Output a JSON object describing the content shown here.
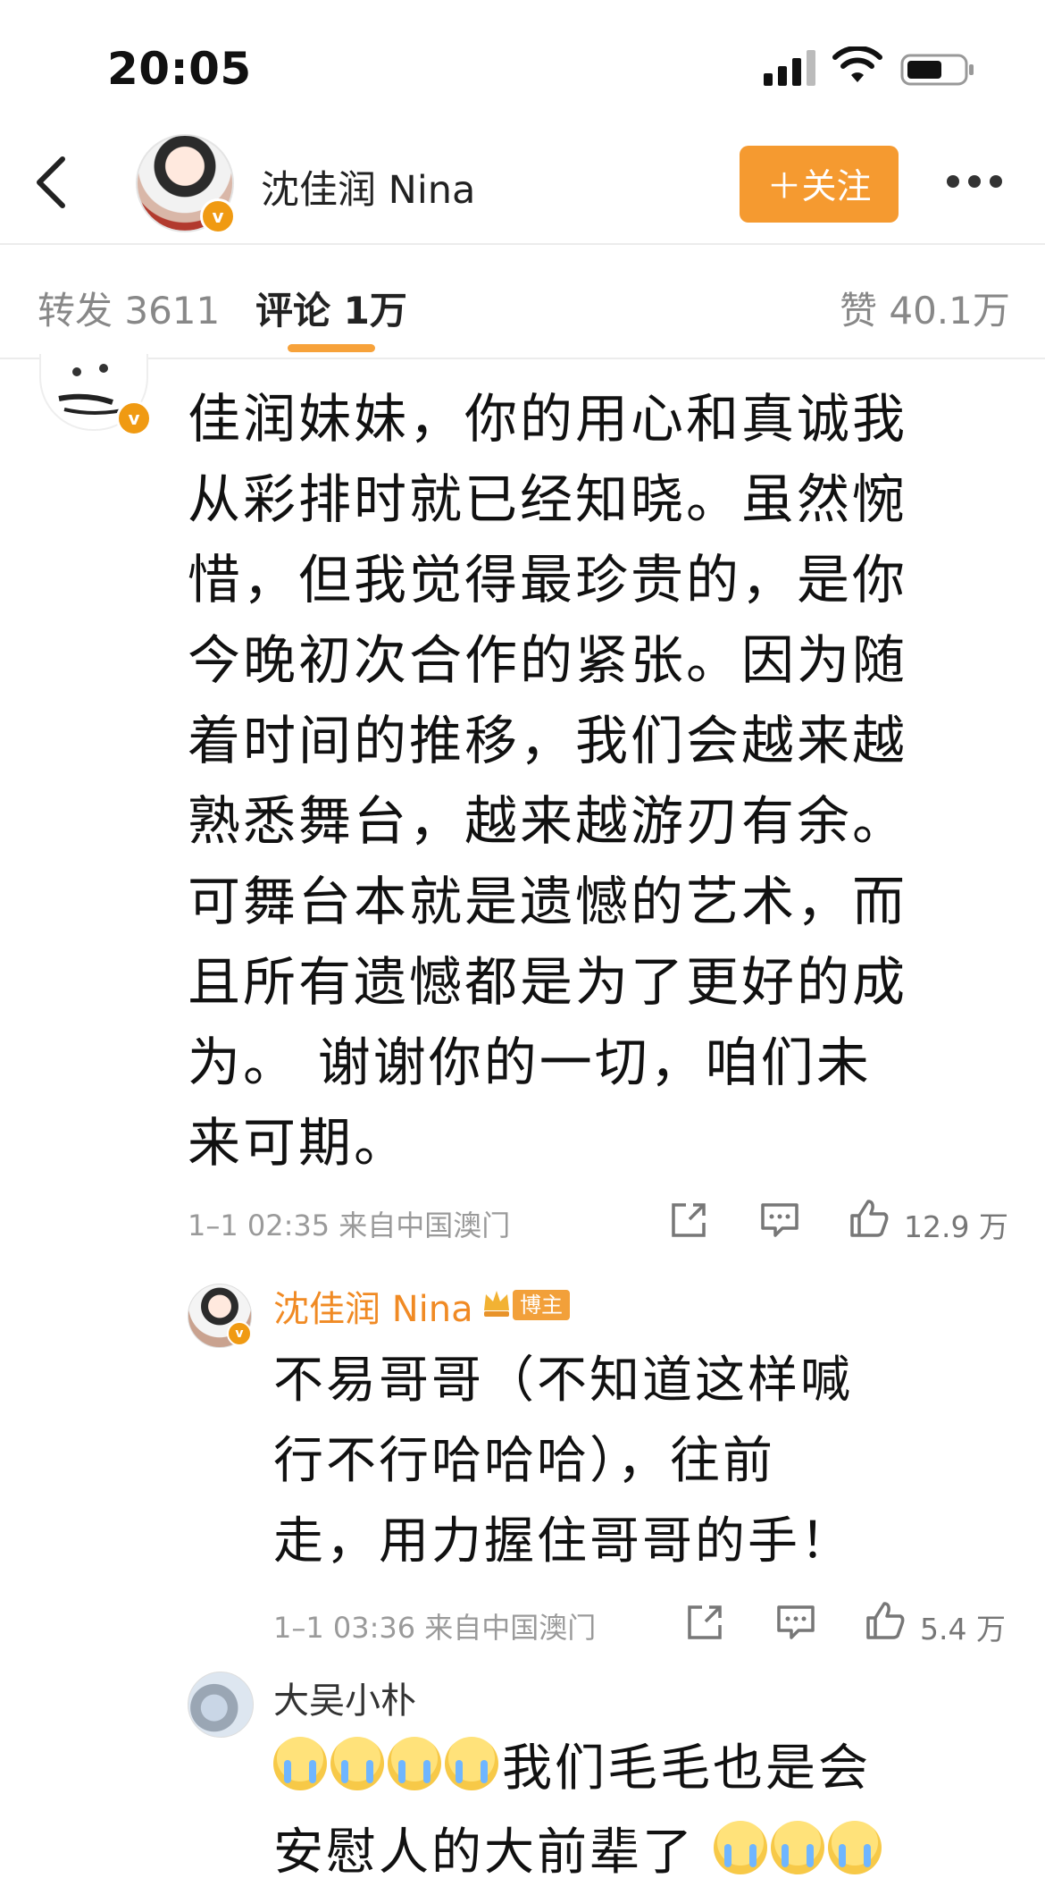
{
  "status_bar": {
    "time": "20:05"
  },
  "header": {
    "username": "沈佳润 Nina",
    "follow_label": "＋关注",
    "verified_badge": "v"
  },
  "tabs": [
    {
      "label": "转发 3611"
    },
    {
      "label": "评论 1万"
    },
    {
      "label": "赞 40.1万"
    }
  ],
  "comment": {
    "text": "佳润妹妹，你的用心和真诚我\n从彩排时就已经知晓。虽然惋\n惜，但我觉得最珍贵的，是你\n今晚初次合作的紧张。因为随\n着时间的推移，我们会越来越\n熟悉舞台，越来越游刃有余。\n可舞台本就是遗憾的艺术，而\n且所有遗憾都是为了更好的成\n为。 谢谢你的一切，咱们未\n来可期。",
    "meta": "1–1 02:35  来自中国澳门",
    "likes": "12.9 万"
  },
  "reply": {
    "username": "沈佳润 Nina",
    "tag": "博主",
    "text": "不易哥哥（不知道这样喊\n行不行哈哈哈），往前\n走，用力握住哥哥的手！",
    "meta": "1–1 03:36  来自中国澳门",
    "likes": "5.4 万"
  },
  "comment3": {
    "username": "大吴小朴",
    "text_line1": "我们毛毛也是会",
    "text_line2": "安慰人的大前辈了"
  },
  "icons": {
    "back": "chevron-left-icon",
    "share": "share-icon",
    "comment": "comment-icon",
    "like": "thumbs-up-icon"
  },
  "colors": {
    "accent_orange": "#f59a30",
    "verified_orange": "#f09a12",
    "reply_name": "#f08a24"
  }
}
